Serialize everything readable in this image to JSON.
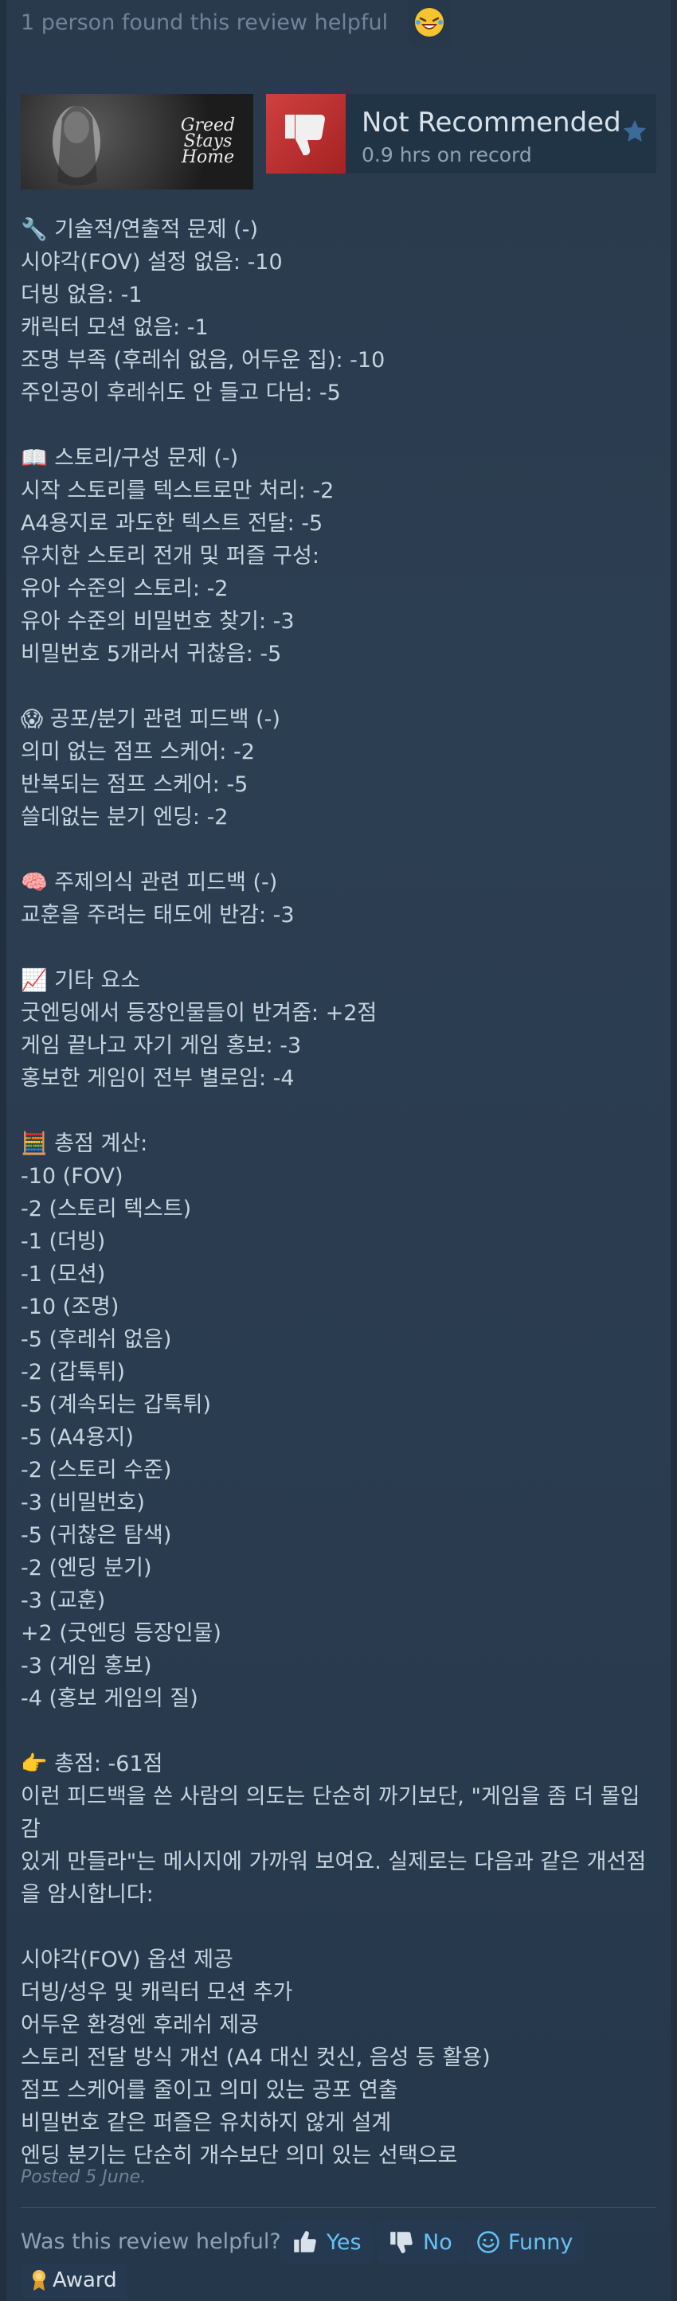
{
  "helpful_top": {
    "count_text": "1 person found this review helpful",
    "award_icon": "laughing-emoji-icon"
  },
  "game": {
    "capsule_logo": "Greed Stays Home"
  },
  "recommendation": {
    "title": "Not Recommended",
    "hours": "0.9 hrs on record",
    "thumb_icon": "thumbs-down-icon",
    "thumb_color": "#c03535",
    "star_icon": "star-icon"
  },
  "review_lines": [
    "🔧 기술적/연출적 문제 (-)",
    "시야각(FOV) 설정 없음: -10",
    "더빙 없음: -1",
    "캐릭터 모션 없음: -1",
    "조명 부족 (후레쉬 없음, 어두운 집): -10",
    "주인공이 후레쉬도 안 들고 다님: -5",
    "",
    "📖 스토리/구성 문제 (-)",
    "시작 스토리를 텍스트로만 처리: -2",
    "A4용지로 과도한 텍스트 전달: -5",
    "유치한 스토리 전개 및 퍼즐 구성:",
    "유아 수준의 스토리: -2",
    "유아 수준의 비밀번호 찾기: -3",
    "비밀번호 5개라서 귀찮음: -5",
    "",
    "😱 공포/분기 관련 피드백 (-)",
    "의미 없는 점프 스케어: -2",
    "반복되는 점프 스케어: -5",
    "쓸데없는 분기 엔딩: -2",
    "",
    "🧠 주제의식 관련 피드백 (-)",
    "교훈을 주려는 태도에 반감: -3",
    "",
    "📈 기타 요소",
    "굿엔딩에서 등장인물들이 반겨줌: +2점",
    "게임 끝나고 자기 게임 홍보: -3",
    "홍보한 게임이 전부 별로임: -4",
    "",
    "🧮 총점 계산:",
    "-10 (FOV)",
    "-2 (스토리 텍스트)",
    "-1 (더빙)",
    "-1 (모션)",
    "-10 (조명)",
    "-5 (후레쉬 없음)",
    "-2 (갑툭튀)",
    "-5 (계속되는 갑툭튀)",
    "-5 (A4용지)",
    "-2 (스토리 수준)",
    "-3 (비밀번호)",
    "-5 (귀찮은 탐색)",
    "-2 (엔딩 분기)",
    "-3 (교훈)",
    "+2 (굿엔딩 등장인물)",
    "-3 (게임 홍보)",
    "-4 (홍보 게임의 질)",
    "",
    "👉 총점: -61점",
    "이런 피드백을 쓴 사람의 의도는 단순히 까기보단, \"게임을 좀 더 몰입감",
    "있게 만들라\"는 메시지에 가까워 보여요. 실제로는 다음과 같은 개선점",
    "을 암시합니다:",
    "",
    "시야각(FOV) 옵션 제공",
    "더빙/성우 및 캐릭터 모션 추가",
    "어두운 환경엔 후레쉬 제공",
    "스토리 전달 방식 개선 (A4 대신 컷신, 음성 등 활용)",
    "점프 스케어를 줄이고 의미 있는 공포 연출",
    "비밀번호 같은 퍼즐은 유치하지 않게 설계",
    "엔딩 분기는 단순히 개수보단 의미 있는 선택으로"
  ],
  "footer": {
    "posted": "Posted 5 June.",
    "helpful_question": "Was this review helpful?",
    "yes_label": "Yes",
    "no_label": "No",
    "funny_label": "Funny",
    "award_label": "Award"
  },
  "colors": {
    "accent": "#67c1f5",
    "background": "#1b2838"
  }
}
